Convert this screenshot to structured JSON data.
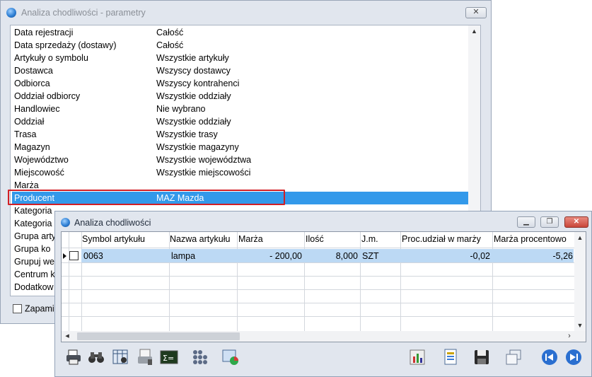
{
  "params_window": {
    "title": "Analiza chodliwości - parametry",
    "rows": [
      {
        "key": "Data rejestracji",
        "value": "Całość"
      },
      {
        "key": "Data sprzedaży (dostawy)",
        "value": "Całość"
      },
      {
        "key": "Artykuły o symbolu",
        "value": "Wszystkie artykuły"
      },
      {
        "key": "Dostawca",
        "value": "Wszyscy dostawcy"
      },
      {
        "key": "Odbiorca",
        "value": "Wszyscy kontrahenci"
      },
      {
        "key": "Oddział odbiorcy",
        "value": "Wszystkie oddziały"
      },
      {
        "key": "Handlowiec",
        "value": "Nie wybrano"
      },
      {
        "key": "Oddział",
        "value": "Wszystkie oddziały"
      },
      {
        "key": "Trasa",
        "value": "Wszystkie trasy"
      },
      {
        "key": "Magazyn",
        "value": "Wszystkie magazyny"
      },
      {
        "key": "Województwo",
        "value": "Wszystkie województwa"
      },
      {
        "key": "Miejscowość",
        "value": "Wszystkie miejscowości"
      },
      {
        "key": "Marża",
        "value": ""
      },
      {
        "key": "Producent",
        "value": "MAZ Mazda"
      },
      {
        "key": "Kategoria",
        "value": ""
      },
      {
        "key": "Kategoria",
        "value": ""
      },
      {
        "key": "Grupa arty",
        "value": ""
      },
      {
        "key": "Grupa ko",
        "value": ""
      },
      {
        "key": "Grupuj we",
        "value": ""
      },
      {
        "key": "Centrum k",
        "value": ""
      },
      {
        "key": "Dodatkow",
        "value": ""
      }
    ],
    "selected_index": 13,
    "save_label": "Zapami"
  },
  "analysis_window": {
    "title": "Analiza chodliwości",
    "columns": [
      "Symbol artykułu",
      "Nazwa artykułu",
      "Marża",
      "Ilość",
      "J.m.",
      "Proc.udział w marży",
      "Marża procentowo"
    ],
    "rows": [
      [
        "0063",
        "lampa",
        "- 200,00",
        "8,000",
        "SZT",
        "-0,02",
        "-5,26"
      ]
    ],
    "toolbar_left": [
      "printer-icon",
      "binoculars-icon",
      "table-search-icon",
      "printer-settings-icon",
      "sum-icon",
      "grid-dots-icon",
      "window-chart-icon"
    ],
    "toolbar_right": [
      "bar-chart-icon",
      "report-icon",
      "save-icon",
      "windows-icon",
      "prev-icon",
      "next-icon"
    ]
  }
}
